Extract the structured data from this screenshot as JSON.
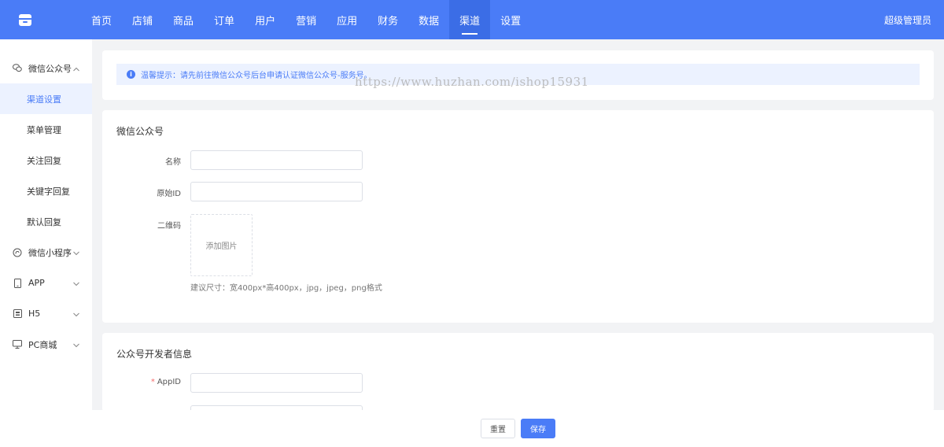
{
  "header": {
    "nav": [
      {
        "label": "首页"
      },
      {
        "label": "店铺"
      },
      {
        "label": "商品"
      },
      {
        "label": "订单"
      },
      {
        "label": "用户"
      },
      {
        "label": "营销"
      },
      {
        "label": "应用"
      },
      {
        "label": "财务"
      },
      {
        "label": "数据"
      },
      {
        "label": "渠道",
        "active": true
      },
      {
        "label": "设置"
      }
    ],
    "user": "超级管理员",
    "logo_icon": "store-icon"
  },
  "sidebar": {
    "groups": [
      {
        "label": "微信公众号",
        "icon": "wechat-icon",
        "expanded": true,
        "items": [
          {
            "label": "渠道设置",
            "active": true
          },
          {
            "label": "菜单管理"
          },
          {
            "label": "关注回复"
          },
          {
            "label": "关键字回复"
          },
          {
            "label": "默认回复"
          }
        ]
      },
      {
        "label": "微信小程序",
        "icon": "miniprogram-icon"
      },
      {
        "label": "APP",
        "icon": "mobile-icon"
      },
      {
        "label": "H5",
        "icon": "h5-icon"
      },
      {
        "label": "PC商城",
        "icon": "monitor-icon"
      }
    ]
  },
  "notice": {
    "text": "温馨提示：请先前往微信公众号后台申请认证微信公众号-服务号。"
  },
  "section1": {
    "title": "微信公众号",
    "fields": [
      {
        "label": "名称",
        "value": ""
      },
      {
        "label": "原始ID",
        "value": ""
      }
    ],
    "qrcode": {
      "label": "二维码",
      "upload_text": "添加图片",
      "hint": "建议尺寸：宽400px*高400px，jpg，jpeg，png格式"
    }
  },
  "section2": {
    "title": "公众号开发者信息",
    "fields": [
      {
        "label": "AppID",
        "required": "*",
        "value": ""
      }
    ]
  },
  "watermark": "https://www.huzhan.com/ishop15931",
  "footer": {
    "reset": "重置",
    "save": "保存"
  },
  "colors": {
    "primary": "#4a7cf7",
    "nav_active": "#3b6de6",
    "notice_bg": "#ecf2ff"
  }
}
